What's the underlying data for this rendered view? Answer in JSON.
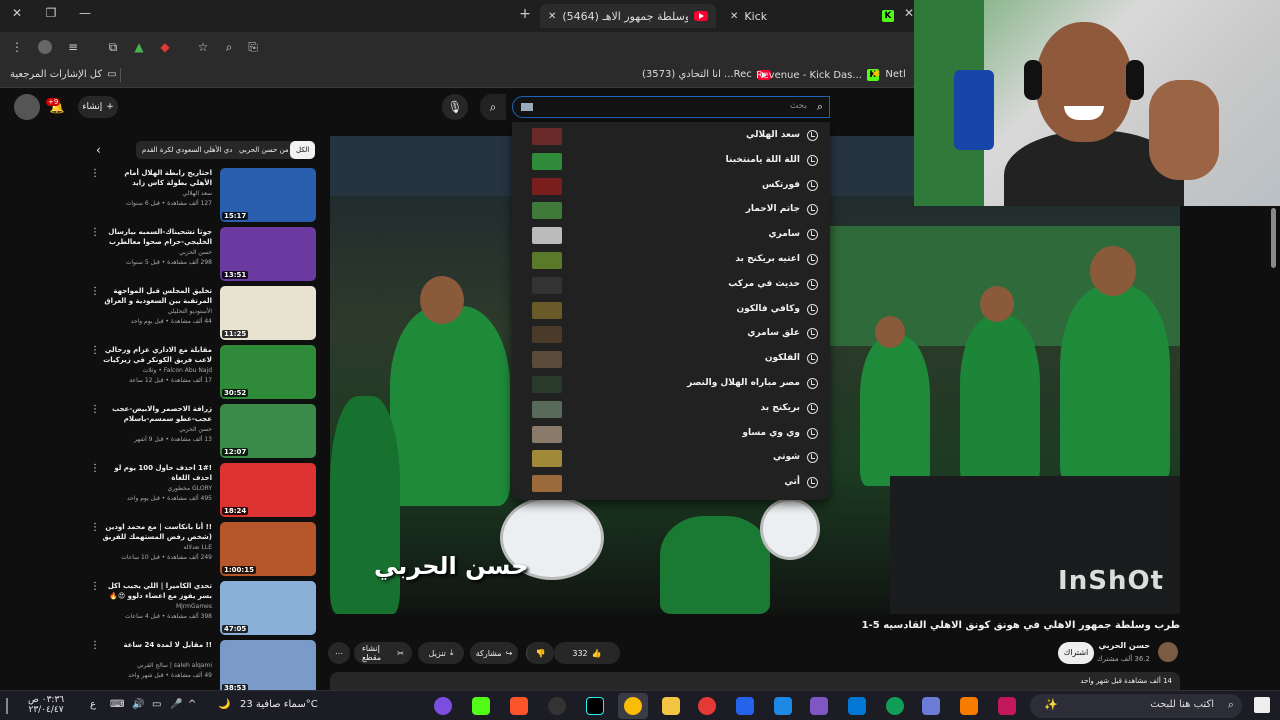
{
  "browser": {
    "tabs": [
      {
        "label": "(5464) طرب وسلطة جمهور الاهـ",
        "active": true
      },
      {
        "label": "Kick",
        "active": false
      }
    ],
    "bookmarks": {
      "all_bookmarks": "كل الإشارات المرجعية",
      "items": [
        "(3573) انا التحادي ...Rec",
        "Revenue - Kick Das...",
        "Netl"
      ]
    }
  },
  "youtube": {
    "create_label": "إنشاء",
    "notification_count": "+9",
    "search": {
      "placeholder": "بحث"
    },
    "suggestions": [
      "سعد الهلالي",
      "اللة اللة يامنتخبنا",
      "فورتكس",
      "جاتم الاحمار",
      "سامري",
      "اعتيه بريكنج بد",
      "حديث في مركب",
      "وكافي فالكون",
      "علق سامري",
      "الفلكون",
      "مصر مباراه الهلال والنصر",
      "بريكنج بد",
      "وي وي مساو",
      "شوتي",
      "أتي"
    ],
    "video": {
      "overlay_name": "حسن الحربي",
      "watermark": "InShOt",
      "title": "طرب وسلطة جمهور الاهلي في هونق كونق الاهلي القادسيه 5-1",
      "channel": "حسن الحربي",
      "subscribers": "36.2 ألف مشترك",
      "subscribe": "اشتراك",
      "likes": "332",
      "share": "مشاركة",
      "download": "تنزيل",
      "clip": "إنشاء مقطع",
      "views": "14 ألف مشاهدة قبل شهر واحد"
    },
    "chips": [
      "الكل",
      "من حسن الحربي",
      "النادي الأهلي السعودي لكرة القدم"
    ],
    "recommendations": [
      {
        "title": "احتاريج رابطة الهلال أمام الأهلي بطولة كاس زايد للكلاسيكية",
        "channel": "سعد الهلالي",
        "meta": "127 ألف مشاهدة • قبل 6 سنوات",
        "duration": "15:17"
      },
      {
        "title": "جوثا تشحيناك-السمبه بيارسال الخليجي-حرام صحوا معالطرب في سال-المحسبيات طرب الترابي",
        "channel": "حسن الحربي",
        "meta": "298 ألف مشاهدة • قبل 5 سنوات",
        "duration": "13:51"
      },
      {
        "title": "تخليق المجلس قبل المواجهة المرتقبة بين السعودية و العراق مباراة تاريخ",
        "channel": "الأستوديو التحليلي",
        "meta": "44 ألف مشاهدة • قبل يوم واحد",
        "duration": "11:25"
      },
      {
        "title": "مقابلة مع الاداري عزام ورحالي لاعب فريق الكونكر في زيركيات انترا terview with...",
        "channel": "Falcon Abu Najd • وثلاث",
        "meta": "17 ألف مشاهدة • قبل 12 ساعة",
        "duration": "30:52"
      },
      {
        "title": "زرافة الاحصمر والابيض-عجب عجب-عطو سمسم-باسلام بالاهلاوي الحطوب بدر ...",
        "channel": "حسن الحربي",
        "meta": "13 ألف مشاهدة • قبل 9 أشهر",
        "duration": "12:07"
      },
      {
        "title": "!1# احذف حاول 100 يوم لو احذف اللغاة",
        "channel": "GLORY مخطوري",
        "meta": "495 ألف مشاهدة • قبل يوم واحد",
        "duration": "18:24"
      },
      {
        "title": "!! أنا بانكاست | مع محمد اودين (شخص رفض المستهمك للفريق 😁",
        "channel": "LLE تعدلالة",
        "meta": "249 ألف مشاهدة • قبل 10 ساعات",
        "duration": "1:00:15"
      },
      {
        "title": "تحدي الكاميرا | اللي يجيب اكل بسر يفوز مع اعضاء دلوو 😍🔥",
        "channel": "MjrmGames",
        "meta": "398 ألف مشاهدة • قبل 4 ساعات",
        "duration": "47:05"
      },
      {
        "title": "!! مقابل لا لمدة 24 ساعة",
        "channel": "saleh alqami | سالح القرني",
        "meta": "49 ألف مشاهدة • قبل شهر واحد",
        "duration": "38:53"
      }
    ]
  },
  "taskbar": {
    "search_placeholder": "اكتب هنا للبحث",
    "weather": "سماء صافية 23°C",
    "time": "٠٣:٣٦ ص",
    "date": "٢٣/٠٤/٤٧",
    "lang": "ع"
  },
  "colors": {
    "youtube_red": "#ff0033",
    "kick_green": "#53fc18",
    "search_focus": "#1c62b9"
  }
}
